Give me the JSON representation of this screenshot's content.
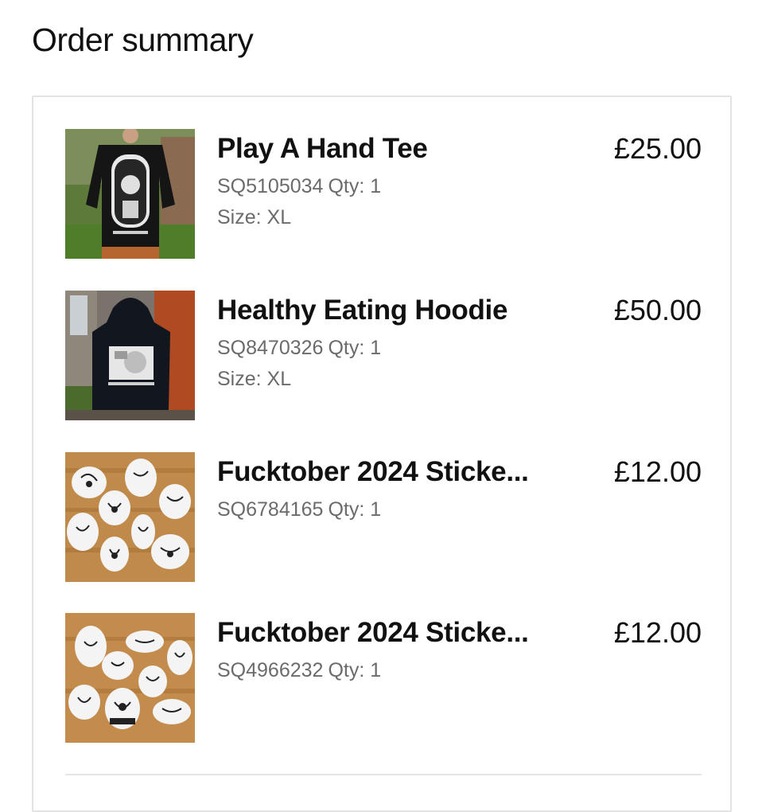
{
  "page": {
    "title": "Order summary"
  },
  "items": [
    {
      "name": "Play A Hand Tee",
      "price": "£25.00",
      "sku": "SQ5105034",
      "qty": "Qty: 1",
      "size": "Size: XL",
      "image": "black-tee-photo"
    },
    {
      "name": "Healthy Eating Hoodie",
      "price": "£50.00",
      "sku": "SQ8470326",
      "qty": "Qty: 1",
      "size": "Size: XL",
      "image": "black-hoodie-photo"
    },
    {
      "name": "Fucktober 2024 Sticke...",
      "price": "£12.00",
      "sku": "SQ6784165",
      "qty": "Qty: 1",
      "image": "sticker-set-photo"
    },
    {
      "name": "Fucktober 2024 Sticke...",
      "price": "£12.00",
      "sku": "SQ4966232",
      "qty": "Qty: 1",
      "image": "sticker-set-photo"
    }
  ],
  "colors": {
    "text": "#111111",
    "muted": "#6b6b6b",
    "border": "#e3e3e3"
  }
}
